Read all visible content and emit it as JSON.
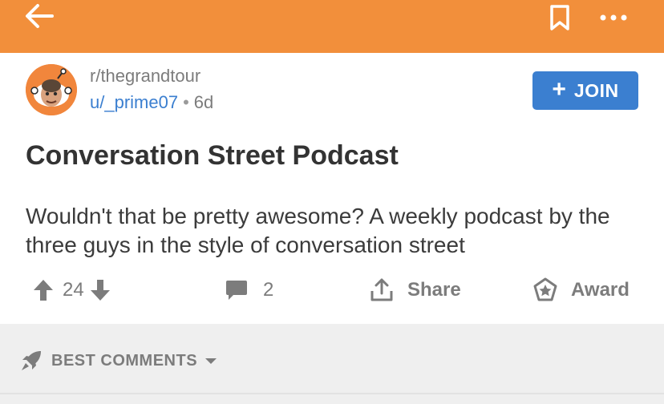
{
  "colors": {
    "accent": "#f28f3b",
    "join": "#3b7fd0",
    "link": "#3b7fd0",
    "icon_gray": "#7c7c7c"
  },
  "topbar": {
    "back_icon": "arrow-left-icon",
    "bookmark_icon": "bookmark-icon",
    "more_icon": "more-horizontal-icon"
  },
  "post": {
    "subreddit": "r/thegrandtour",
    "username": "u/_prime07",
    "separator": "•",
    "age": "6d",
    "join_label": "JOIN",
    "title": "Conversation Street Podcast",
    "body": "Wouldn't that be pretty awesome? A weekly podcast by the three guys in the style of conversation street"
  },
  "actions": {
    "vote_count": "24",
    "comment_count": "2",
    "share_label": "Share",
    "award_label": "Award"
  },
  "comments": {
    "sort_label": "BEST COMMENTS",
    "sort_icon": "rocket-icon"
  }
}
